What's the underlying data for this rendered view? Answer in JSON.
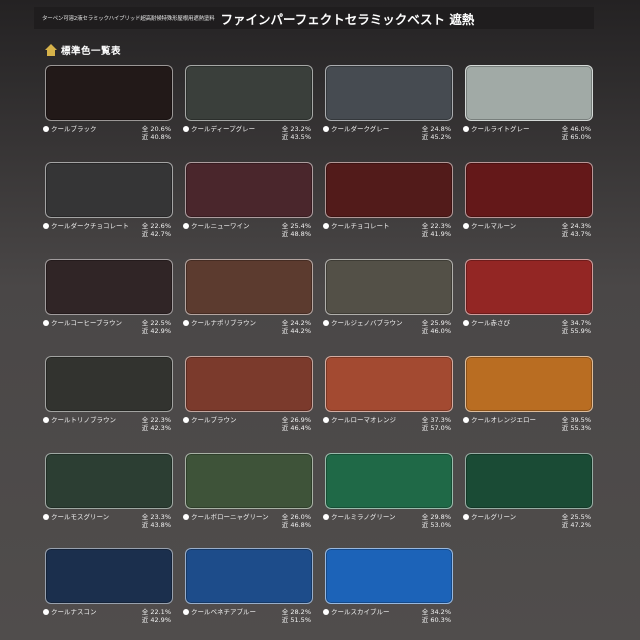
{
  "header": {
    "subtitle": "ターペン可溶2液セラミックハイブリッド超高耐候特殊形屋根用遮熱塗料",
    "title": "ファインパーフェクトセラミックベスト 遮熱"
  },
  "section": {
    "title": "標準色一覧表"
  },
  "colors": [
    {
      "name": "クールブラック",
      "zen": "全 20.6%",
      "kin": "近 40.8%",
      "hex": "#221918"
    },
    {
      "name": "クールディープグレー",
      "zen": "全 23.2%",
      "kin": "近 43.5%",
      "hex": "#3a3f3b"
    },
    {
      "name": "クールダークグレー",
      "zen": "全 24.8%",
      "kin": "近 45.2%",
      "hex": "#464b51"
    },
    {
      "name": "クールライトグレー",
      "zen": "全 46.0%",
      "kin": "近 65.0%",
      "hex": "#a1aaa6"
    },
    {
      "name": "クールダークチョコレート",
      "zen": "全 22.6%",
      "kin": "近 42.7%",
      "hex": "#353536"
    },
    {
      "name": "クールニューワイン",
      "zen": "全 25.4%",
      "kin": "近 48.8%",
      "hex": "#4a262c"
    },
    {
      "name": "クールチョコレート",
      "zen": "全 22.3%",
      "kin": "近 41.9%",
      "hex": "#521b1a"
    },
    {
      "name": "クールマルーン",
      "zen": "全 24.3%",
      "kin": "近 43.7%",
      "hex": "#641819"
    },
    {
      "name": "クールコーヒーブラウン",
      "zen": "全 22.5%",
      "kin": "近 42.9%",
      "hex": "#302526"
    },
    {
      "name": "クールナポリブラウン",
      "zen": "全 24.2%",
      "kin": "近 44.2%",
      "hex": "#5c3b2f"
    },
    {
      "name": "クールジェノバブラウン",
      "zen": "全 25.9%",
      "kin": "近 46.0%",
      "hex": "#535047"
    },
    {
      "name": "クール赤さび",
      "zen": "全 34.7%",
      "kin": "近 55.9%",
      "hex": "#932624"
    },
    {
      "name": "クールトリノブラウン",
      "zen": "全 22.3%",
      "kin": "近 42.3%",
      "hex": "#32332f"
    },
    {
      "name": "クールブラウン",
      "zen": "全 26.9%",
      "kin": "近 46.4%",
      "hex": "#7b3a2c"
    },
    {
      "name": "クールローマオレンジ",
      "zen": "全 37.3%",
      "kin": "近 57.0%",
      "hex": "#a34a31"
    },
    {
      "name": "クールオレンジエロー",
      "zen": "全 39.5%",
      "kin": "近 55.3%",
      "hex": "#b96d22"
    },
    {
      "name": "クールモスグリーン",
      "zen": "全 23.3%",
      "kin": "近 43.8%",
      "hex": "#2c3e33"
    },
    {
      "name": "クールボローニャグリーン",
      "zen": "全 26.0%",
      "kin": "近 46.8%",
      "hex": "#3e5339"
    },
    {
      "name": "クールミラノグリーン",
      "zen": "全 29.8%",
      "kin": "近 53.0%",
      "hex": "#1f6947"
    },
    {
      "name": "クールグリーン",
      "zen": "全 25.5%",
      "kin": "近 47.2%",
      "hex": "#1a4b35"
    },
    {
      "name": "クールナスコン",
      "zen": "全 22.1%",
      "kin": "近 42.9%",
      "hex": "#1b2f4d"
    },
    {
      "name": "クールベネチアブルー",
      "zen": "全 28.2%",
      "kin": "近 51.5%",
      "hex": "#1d4c8a"
    },
    {
      "name": "クールスカイブルー",
      "zen": "全 34.2%",
      "kin": "近 60.3%",
      "hex": "#1c63b8"
    }
  ]
}
